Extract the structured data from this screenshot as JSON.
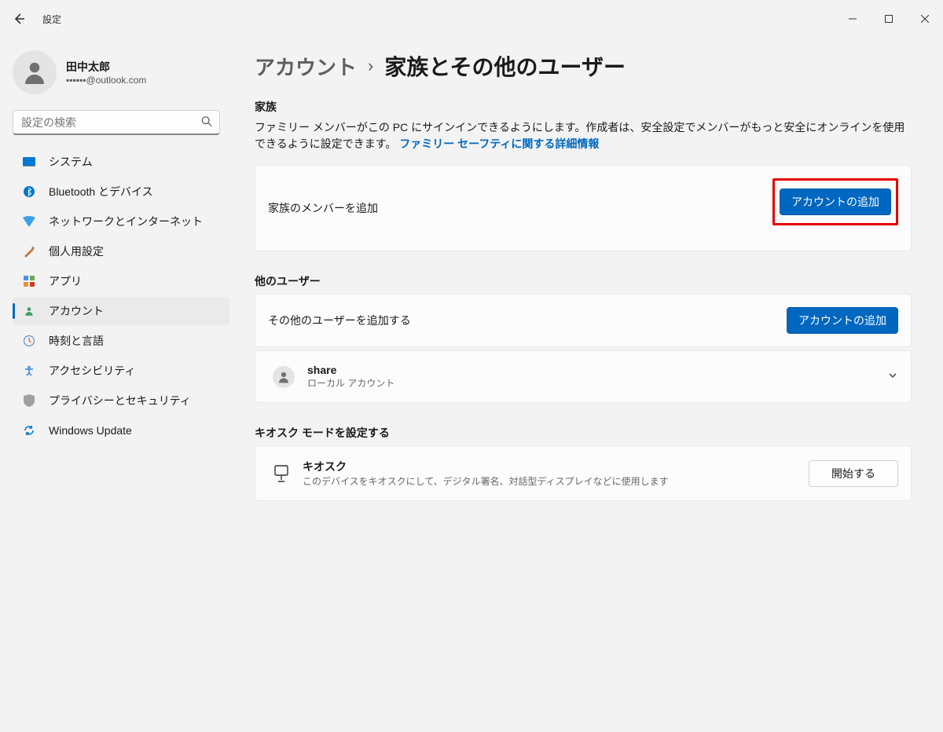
{
  "window": {
    "title": "設定"
  },
  "profile": {
    "name": "田中太郎",
    "email": "▪▪▪▪▪▪@outlook.com"
  },
  "search": {
    "placeholder": "設定の検索"
  },
  "nav": {
    "items": [
      {
        "label": "システム"
      },
      {
        "label": "Bluetooth とデバイス"
      },
      {
        "label": "ネットワークとインターネット"
      },
      {
        "label": "個人用設定"
      },
      {
        "label": "アプリ"
      },
      {
        "label": "アカウント"
      },
      {
        "label": "時刻と言語"
      },
      {
        "label": "アクセシビリティ"
      },
      {
        "label": "プライバシーとセキュリティ"
      },
      {
        "label": "Windows Update"
      }
    ]
  },
  "breadcrumb": {
    "parent": "アカウント",
    "current": "家族とその他のユーザー"
  },
  "family": {
    "heading": "家族",
    "description": "ファミリー メンバーがこの PC にサインインできるようにします。作成者は、安全設定でメンバーがもっと安全にオンラインを使用できるように設定できます。 ",
    "link": "ファミリー セーフティに関する詳細情報",
    "add_member_label": "家族のメンバーを追加",
    "add_account_button": "アカウントの追加"
  },
  "other_users": {
    "heading": "他のユーザー",
    "add_other_label": "その他のユーザーを追加する",
    "add_account_button": "アカウントの追加",
    "accounts": [
      {
        "name": "share",
        "type": "ローカル アカウント"
      }
    ]
  },
  "kiosk": {
    "heading": "キオスク モードを設定する",
    "title": "キオスク",
    "description": "このデバイスをキオスクにして、デジタル署名、対話型ディスプレイなどに使用します",
    "start_button": "開始する"
  }
}
